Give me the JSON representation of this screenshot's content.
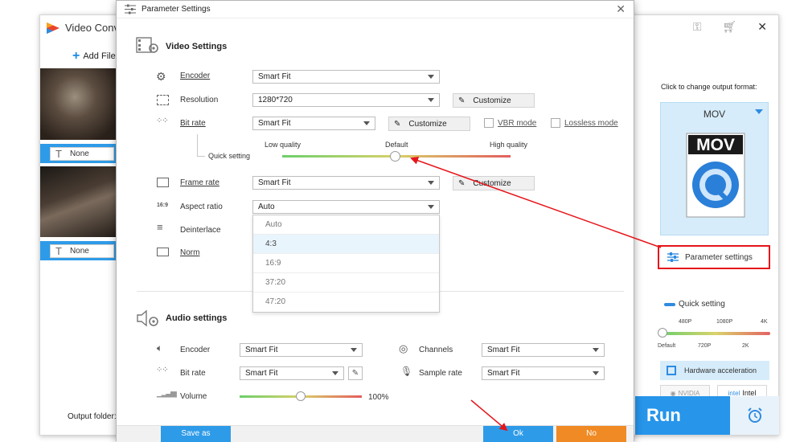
{
  "app": {
    "title": "Video Conv",
    "add_files": "Add File",
    "subtitle_1": "None",
    "subtitle_2": "None",
    "output_folder": "Output folder:",
    "run": "Run"
  },
  "right_panel": {
    "click_change": "Click to change output format:",
    "format_name": "MOV",
    "format_logo": "MOV",
    "parameter_settings": "Parameter settings",
    "quick_setting": "Quick setting",
    "ticks_top": [
      "480P",
      "1080P",
      "4K"
    ],
    "ticks_bottom": [
      "Default",
      "720P",
      "2K"
    ],
    "hw_accel": "Hardware acceleration",
    "nvidia": "NVIDIA",
    "intel": "Intel"
  },
  "dialog": {
    "title": "Parameter Settings",
    "video_title": "Video Settings",
    "audio_title": "Audio settings",
    "video": {
      "encoder_label": "Encoder",
      "encoder_value": "Smart Fit",
      "resolution_label": "Resolution",
      "resolution_value": "1280*720",
      "resolution_btn": "Customize",
      "bitrate_label": "Bit rate",
      "bitrate_value": "Smart Fit",
      "bitrate_btn": "Customize",
      "vbr_mode": "VBR mode",
      "lossless_mode": "Lossless mode",
      "quick_setting": "Quick setting",
      "low_quality": "Low quality",
      "default": "Default",
      "high_quality": "High quality",
      "quality_level": 0.5,
      "framerate_label": "Frame rate",
      "framerate_value": "Smart Fit",
      "framerate_btn": "Customize",
      "aspect_label": "Aspect ratio",
      "aspect_value": "Auto",
      "aspect_icon_text": "16:9",
      "deinterlace_label": "Deinterlace",
      "norm_label": "Norm",
      "aspect_options": [
        "Auto",
        "4:3",
        "16:9",
        "37:20",
        "47:20"
      ],
      "aspect_highlighted": "4:3"
    },
    "audio": {
      "encoder_label": "Encoder",
      "encoder_value": "Smart Fit",
      "bitrate_label": "Bit rate",
      "bitrate_value": "Smart Fit",
      "volume_label": "Volume",
      "volume_value": "100%",
      "channels_label": "Channels",
      "channels_value": "Smart Fit",
      "samplerate_label": "Sample rate",
      "samplerate_value": "Smart Fit"
    },
    "save_as": "Save as",
    "ok": "Ok",
    "no": "No"
  },
  "colors": {
    "accent": "#2e9be8",
    "highlight_red": "#e5161b",
    "no_button": "#f08a24"
  }
}
